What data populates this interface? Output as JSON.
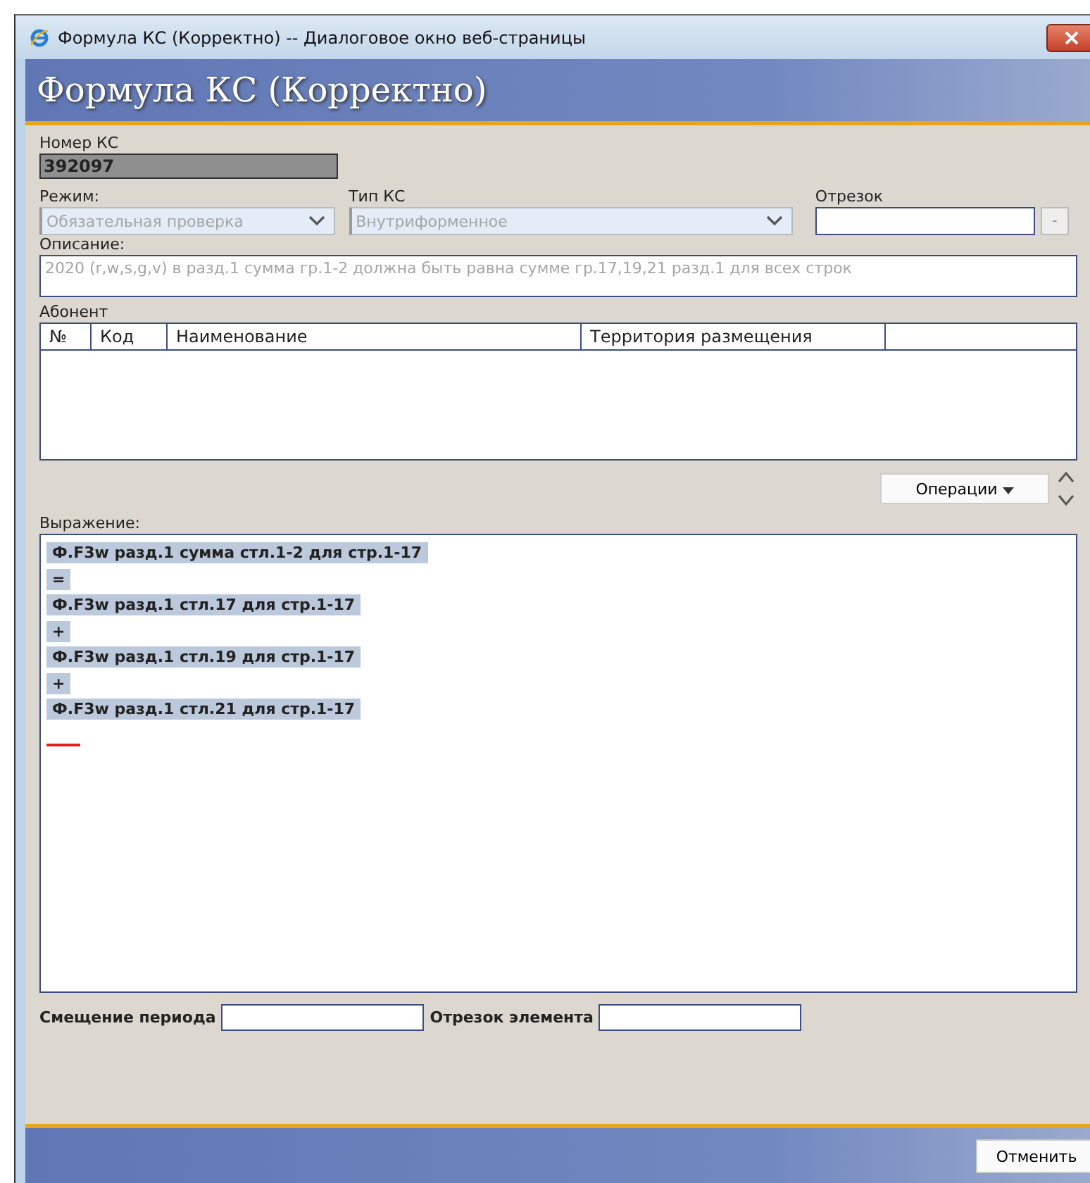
{
  "window": {
    "title": "Формула КС (Корректно) -- Диалоговое окно веб-страницы"
  },
  "header": {
    "title": "Формула КС (Корректно)"
  },
  "number": {
    "label": "Номер КС",
    "value": "392097"
  },
  "mode": {
    "label": "Режим:",
    "value": "Обязательная проверка",
    "disabled": true
  },
  "type": {
    "label": "Тип КС",
    "value": "Внутриформенное",
    "disabled": true
  },
  "segment": {
    "label": "Отрезок",
    "button": "-"
  },
  "description": {
    "label": "Описание:",
    "value": "2020 (r,w,s,g,v) в разд.1  сумма гр.1-2 должна быть равна сумме гр.17,19,21 разд.1 для всех строк",
    "disabled": true
  },
  "subscriber": {
    "label": "Абонент",
    "columns": [
      "№",
      "Код",
      "Наименование",
      "Территория размещения"
    ]
  },
  "operations_button": "Операции",
  "expression": {
    "label": "Выражение:",
    "tokens": [
      {
        "text": "Ф.F3w разд.1 сумма стл.1-2 для стр.1-17"
      },
      {
        "text": "="
      },
      {
        "text": "Ф.F3w разд.1 стл.17 для стр.1-17"
      },
      {
        "text": "+"
      },
      {
        "text": "Ф.F3w разд.1 стл.19 для стр.1-17"
      },
      {
        "text": "+"
      },
      {
        "text": "Ф.F3w разд.1 стл.21 для стр.1-17"
      }
    ]
  },
  "period_shift": {
    "label": "Смещение периода"
  },
  "element_segment": {
    "label": "Отрезок элемента"
  },
  "cancel_button": "Отменить"
}
